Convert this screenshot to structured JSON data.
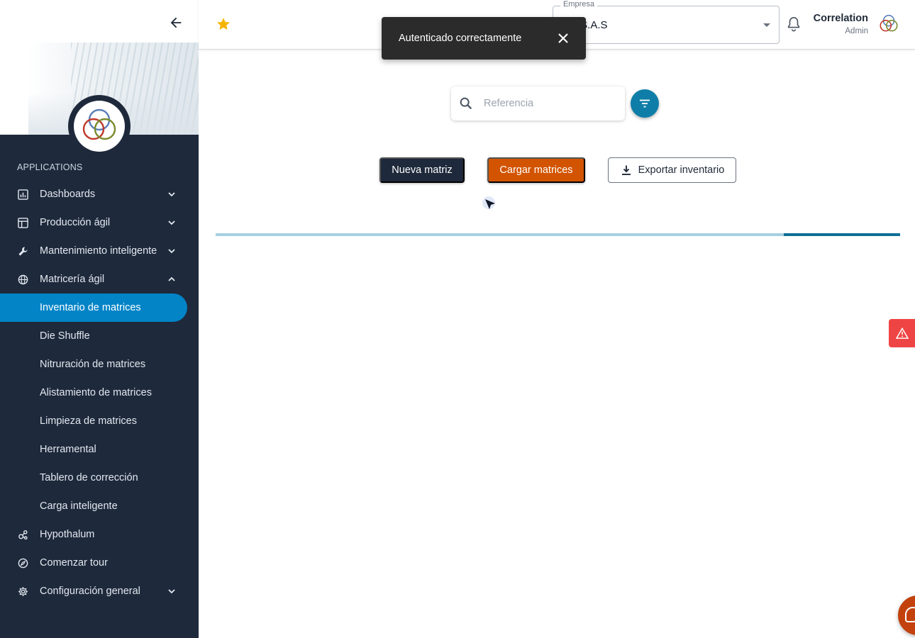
{
  "sidebar": {
    "section_label": "APPLICATIONS",
    "items": [
      {
        "label": "Dashboards",
        "icon": "bar-chart-icon",
        "has_chevron": true
      },
      {
        "label": "Producción ágil",
        "icon": "layout-icon",
        "has_chevron": true
      },
      {
        "label": "Mantenimiento inteligente",
        "icon": "wrench-icon",
        "has_chevron": true
      },
      {
        "label": "Matricería ágil",
        "icon": "globe-icon",
        "expanded": true,
        "subitems": [
          {
            "label": "Inventario de matrices",
            "active": true
          },
          {
            "label": "Die Shuffle"
          },
          {
            "label": "Nitruración de matrices"
          },
          {
            "label": "Alistamiento de matrices"
          },
          {
            "label": "Limpieza de matrices"
          },
          {
            "label": "Herramental"
          },
          {
            "label": "Tablero de corrección"
          },
          {
            "label": "Carga inteligente"
          }
        ]
      },
      {
        "label": "Hypothalum",
        "icon": "hub-icon"
      },
      {
        "label": "Comenzar tour",
        "icon": "compass-icon"
      },
      {
        "label": "Configuración general",
        "icon": "gear-icon",
        "has_chevron": true
      }
    ]
  },
  "header": {
    "company_label": "Empresa",
    "company_value": "CA S.A.S",
    "user_name": "Correlation",
    "user_role": "Admin"
  },
  "toast": {
    "message": "Autenticado correctamente"
  },
  "search": {
    "placeholder": "Referencia",
    "value": ""
  },
  "actions": {
    "new_label": "Nueva matriz",
    "load_label": "Cargar matrices",
    "export_label": "Exportar inventario"
  },
  "loading": {
    "progress_fraction_start": 0.83,
    "progress_fraction_end": 1.0
  },
  "colors": {
    "sidebar_bg": "#1e293b",
    "active_item": "#0284c7",
    "load_button": "#d35400",
    "filter_button": "#0e7ea8",
    "alert": "#ef4444",
    "star": "#f5b400"
  }
}
